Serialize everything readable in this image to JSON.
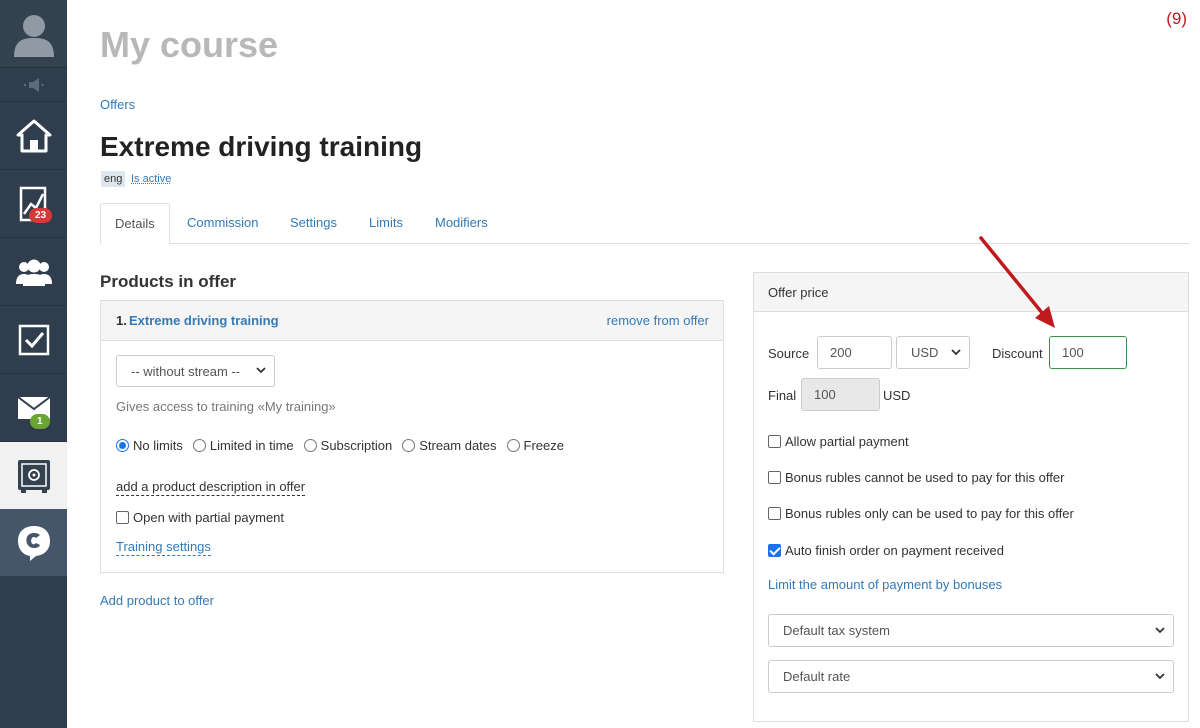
{
  "page_marker": "(9)",
  "sidebar": {
    "chart_badge": "23",
    "mail_badge": "1"
  },
  "header": {
    "course_title": "My course",
    "breadcrumb": "Offers",
    "offer_title": "Extreme driving training",
    "lang": "eng",
    "status": "Is active"
  },
  "tabs": [
    "Details",
    "Commission",
    "Settings",
    "Limits",
    "Modifiers"
  ],
  "products": {
    "heading": "Products in offer",
    "item_number": "1.",
    "item_name": "Extreme driving training",
    "remove_label": "remove from offer",
    "stream_select": "-- without stream --",
    "gives_access": "Gives access to training «My training»",
    "access_options": [
      {
        "label": "No limits",
        "selected": true
      },
      {
        "label": "Limited in time",
        "selected": false
      },
      {
        "label": "Subscription",
        "selected": false
      },
      {
        "label": "Stream dates",
        "selected": false
      },
      {
        "label": "Freeze",
        "selected": false
      }
    ],
    "add_description": "add a product description in offer",
    "open_partial": "Open with partial payment",
    "training_settings": "Training settings",
    "add_product": "Add product to offer"
  },
  "price": {
    "heading": "Offer price",
    "source_label": "Source",
    "source_value": "200",
    "currency": "USD",
    "discount_label": "Discount",
    "discount_value": "100",
    "final_label": "Final",
    "final_value": "100",
    "final_currency": "USD",
    "options": [
      {
        "label": "Allow partial payment",
        "checked": false
      },
      {
        "label": "Bonus rubles cannot be used to pay for this offer",
        "checked": false
      },
      {
        "label": "Bonus rubles only can be used to pay for this offer",
        "checked": false
      },
      {
        "label": "Auto finish order on payment received",
        "checked": true
      }
    ],
    "limit_link": "Limit the amount of payment by bonuses",
    "tax_select": "Default tax system",
    "rate_select": "Default rate"
  },
  "colors": {
    "sidebar_bg": "#2f3d4d",
    "link": "#337ab7",
    "arrow": "#c0191e"
  }
}
